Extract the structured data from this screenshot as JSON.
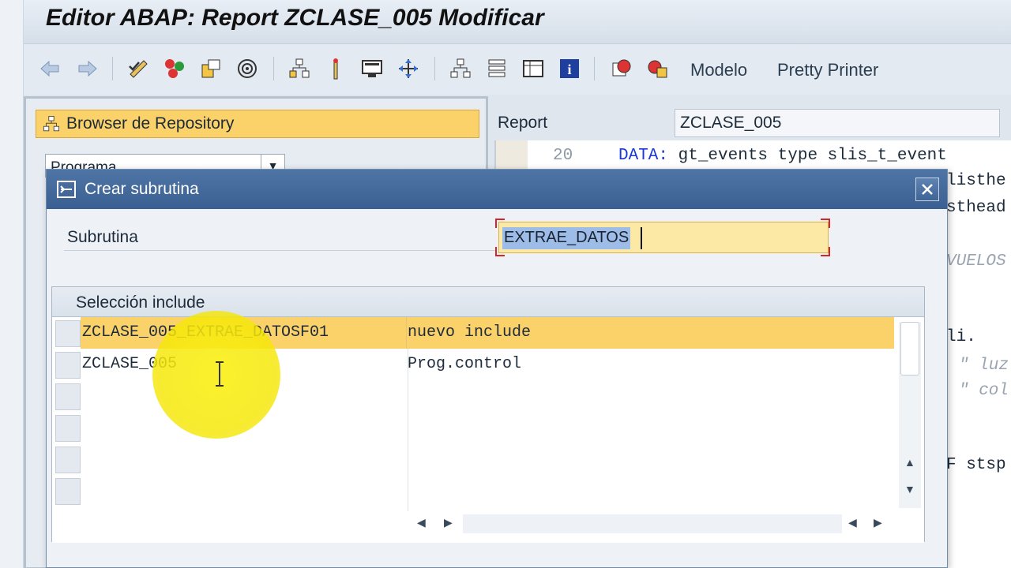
{
  "window": {
    "title": "Editor ABAP: Report ZCLASE_005 Modificar"
  },
  "toolbar": {
    "icons": [
      "back-arrow-icon",
      "forward-arrow-icon",
      "check-icon",
      "activate-icon",
      "display-change-icon",
      "where-used-icon",
      "object-list-icon",
      "insert-icon",
      "screen-icon",
      "move-icon",
      "hierarchy-icon",
      "stack-icon",
      "table-icon",
      "info-icon",
      "breakpoint-icon",
      "watchpoint-icon"
    ],
    "modelo_label": "Modelo",
    "pretty_printer_label": "Pretty Printer"
  },
  "repository": {
    "title": "Browser de Repository",
    "object_type": "Programa"
  },
  "editor": {
    "report_label": "Report",
    "report_value": "ZCLASE_005",
    "line_number": "20",
    "lines": [
      {
        "kw": "DATA:",
        "text": " gt_events type slis_t_event"
      },
      {
        "text": "listhe"
      },
      {
        "text": "sthead"
      },
      {
        "comment": "VUELOS"
      },
      {
        "text": "li."
      },
      {
        "comment": "\" luz"
      },
      {
        "comment": "\" col"
      },
      {
        "text": "F stsp"
      }
    ]
  },
  "dialog": {
    "title": "Crear subrutina",
    "subrutina_label": "Subrutina",
    "subrutina_value": "EXTRAE_DATOS",
    "group_title": "Selección include",
    "rows": [
      {
        "include": "ZCLASE_005_EXTRAE_DATOSF01",
        "description": "nuevo include"
      },
      {
        "include": "ZCLASE_005",
        "description": "Prog.control"
      }
    ]
  },
  "colors": {
    "selection": "#fbd26a",
    "dialog_title": "#3a5f92",
    "keyword": "#1b37d6"
  }
}
